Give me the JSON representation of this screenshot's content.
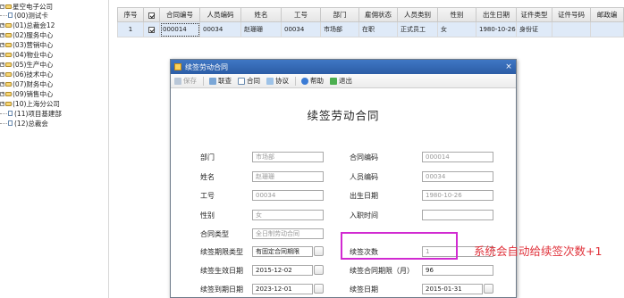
{
  "tree": {
    "root": "星空电子公司",
    "items": [
      "(00)测试卡",
      "(01)总裁会12",
      "(02)服务中心",
      "(03)营销中心",
      "(04)物业中心",
      "(05)生产中心",
      "(06)技术中心",
      "(07)财务中心",
      "(09)销售中心",
      "(10)上海分公司",
      "(11)项目基建部",
      "(12)总裁会"
    ]
  },
  "grid": {
    "headers": [
      "序号",
      "",
      "合同编号",
      "人员编码",
      "姓名",
      "工号",
      "部门",
      "雇佣状态",
      "人员类别",
      "性别",
      "出生日期",
      "证件类型",
      "证件号码",
      "邮政编"
    ],
    "row": [
      "1",
      "",
      "000014",
      "00034",
      "赵珊珊",
      "00034",
      "市场部",
      "在职",
      "正式员工",
      "女",
      "1980-10-26",
      "身份证",
      "",
      ""
    ]
  },
  "dialog": {
    "title": "续签劳动合同",
    "close": "×",
    "toolbar": {
      "save": "保存",
      "preview": "联查",
      "contract": "合同",
      "agreement": "协议",
      "help": "帮助",
      "exit": "退出"
    },
    "form_title": "续签劳动合同",
    "fields": {
      "dept_label": "部门",
      "dept_value": "市场部",
      "contract_no_label": "合同编码",
      "contract_no_value": "000014",
      "name_label": "姓名",
      "name_value": "赵珊珊",
      "person_code_label": "人员编码",
      "person_code_value": "00034",
      "job_no_label": "工号",
      "job_no_value": "00034",
      "birth_label": "出生日期",
      "birth_value": "1980-10-26",
      "gender_label": "性别",
      "gender_value": "女",
      "entry_label": "入职时间",
      "entry_value": "",
      "type_label": "合同类型",
      "type_value": "全日制劳动合同",
      "term_label": "续签期限类型",
      "term_value": "有固定合同期限",
      "count_label": "续签次数",
      "count_value": "1",
      "start_label": "续签生效日期",
      "start_value": "2015-12-02",
      "period_label": "续签合同期限（月）",
      "period_value": "96",
      "end_label": "续签到期日期",
      "end_value": "2023-12-01",
      "renew_label": "续签日期",
      "renew_value": "2015-01-31"
    }
  },
  "annotation": "系统会自动给续签次数+1",
  "colors": {
    "highlight_box": "#d12ad1",
    "annotation_text": "#e0313a",
    "selected_row": "#dfeaf8",
    "titlebar": "#2c5da6"
  }
}
